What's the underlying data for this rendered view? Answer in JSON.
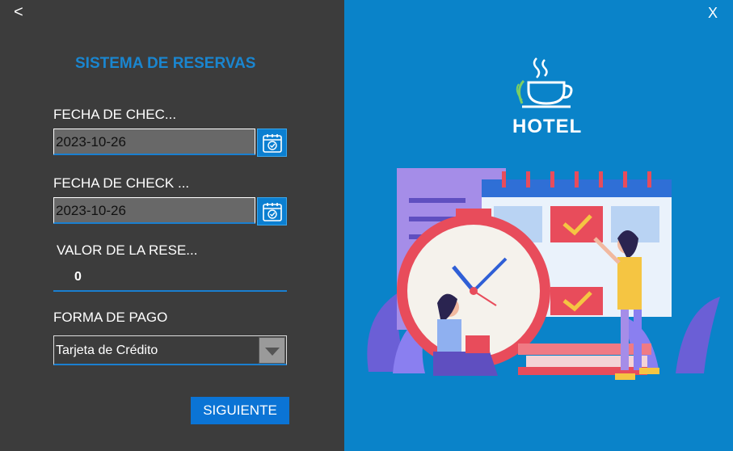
{
  "window": {
    "back_label": "<",
    "close_label": "X"
  },
  "form": {
    "title": "SISTEMA DE RESERVAS",
    "checkin_label": "FECHA DE CHEC...",
    "checkin_value": "2023-10-26",
    "checkout_label": "FECHA DE CHECK ...",
    "checkout_value": "2023-10-26",
    "amount_label": "VALOR DE LA RESE...",
    "amount_value": "0",
    "payment_label": "FORMA DE PAGO",
    "payment_selected": "Tarjeta de Crédito",
    "next_label": "SIGUIENTE"
  },
  "brand": {
    "logo_text": "HOTEL"
  },
  "icons": {
    "calendar": "calendar-check-icon",
    "dropdown": "chevron-down-icon",
    "logo": "coffee-cup-icon"
  },
  "colors": {
    "accent": "#1a86d0",
    "panel_dark": "#3c3c3c",
    "panel_blue": "#0a83c9",
    "button": "#0b74d5"
  }
}
